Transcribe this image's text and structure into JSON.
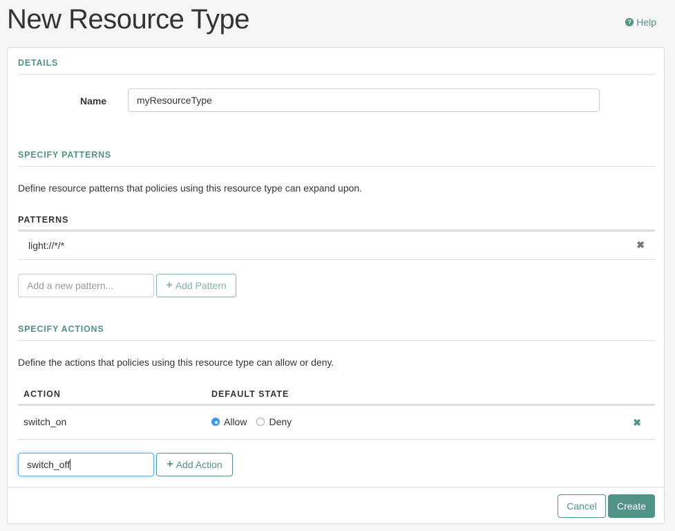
{
  "header": {
    "title": "New Resource Type",
    "help_label": "Help",
    "help_icon": "question-circle-icon"
  },
  "details": {
    "heading": "DETAILS",
    "name_label": "Name",
    "name_value": "myResourceType"
  },
  "patterns": {
    "heading": "SPECIFY PATTERNS",
    "description": "Define resource patterns that policies using this resource type can expand upon.",
    "column_header": "PATTERNS",
    "rows": [
      {
        "value": "light://*/*",
        "remove_icon": "times-icon"
      }
    ],
    "new_placeholder": "Add a new pattern...",
    "new_value": "",
    "add_button_label": "Add Pattern"
  },
  "actions": {
    "heading": "SPECIFY ACTIONS",
    "description": "Define the actions that policies using this resource type can allow or deny.",
    "columns": [
      "ACTION",
      "DEFAULT STATE"
    ],
    "rows": [
      {
        "action": "switch_on",
        "default_state": "Allow",
        "options": [
          "Allow",
          "Deny"
        ],
        "remove_icon": "times-icon"
      }
    ],
    "new_value": "switch_off",
    "add_button_label": "Add Action"
  },
  "footer": {
    "cancel_label": "Cancel",
    "create_label": "Create"
  },
  "colors": {
    "accent": "#519387",
    "radio_checked": "#3b99fc",
    "focus_border": "#66afe9",
    "background": "#f5f5f5"
  }
}
